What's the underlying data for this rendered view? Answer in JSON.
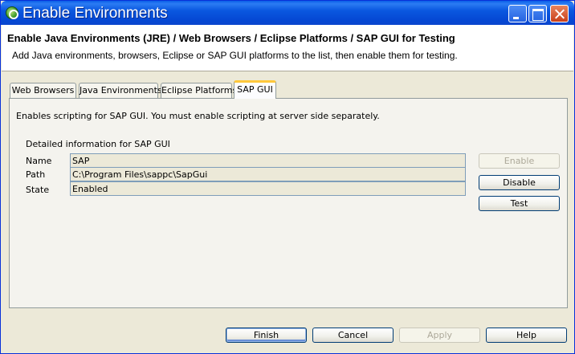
{
  "window": {
    "title": "Enable Environments"
  },
  "header": {
    "title": "Enable Java Environments (JRE) / Web Browsers / Eclipse Platforms / SAP GUI for Testing",
    "description": "Add Java environments, browsers, Eclipse or SAP GUI platforms to the list, then enable them for testing."
  },
  "tabs": [
    {
      "label": "Web Browsers",
      "active": false
    },
    {
      "label": "Java Environments",
      "active": false
    },
    {
      "label": "Eclipse Platforms",
      "active": false
    },
    {
      "label": "SAP GUI",
      "active": true
    }
  ],
  "panel": {
    "note": "Enables scripting for SAP GUI. You must enable scripting at server side separately.",
    "detail_title": "Detailed information for SAP GUI",
    "fields": [
      {
        "label": "Name",
        "value": "SAP"
      },
      {
        "label": "Path",
        "value": "C:\\Program Files\\sappc\\SapGui"
      },
      {
        "label": "State",
        "value": "Enabled"
      }
    ],
    "buttons": {
      "enable": "Enable",
      "disable": "Disable",
      "test": "Test"
    }
  },
  "footer": {
    "finish": "Finish",
    "cancel": "Cancel",
    "apply": "Apply",
    "help": "Help"
  },
  "colors": {
    "titlebar": "#0a58e0",
    "active_tab_accent": "#ffc83c",
    "window_bg": "#ece9d8"
  }
}
